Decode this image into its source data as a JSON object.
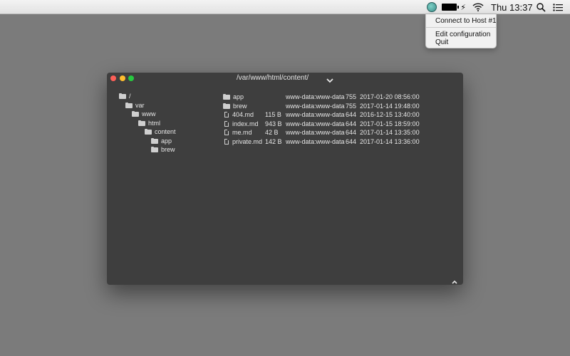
{
  "menubar": {
    "clock": "Thu 13:37",
    "icons": [
      "app-status-icon",
      "battery-icon",
      "wifi-icon",
      "search-icon",
      "list-icon"
    ]
  },
  "menu": {
    "items": [
      "Connect to Host #1",
      "Edit configuration",
      "Quit"
    ]
  },
  "window": {
    "title": "/var/www/html/content/",
    "tree": [
      {
        "label": "/",
        "depth": 0
      },
      {
        "label": "var",
        "depth": 1
      },
      {
        "label": "www",
        "depth": 2
      },
      {
        "label": "html",
        "depth": 3
      },
      {
        "label": "content",
        "depth": 4
      },
      {
        "label": "app",
        "depth": 5
      },
      {
        "label": "brew",
        "depth": 5
      }
    ],
    "files": [
      {
        "type": "folder",
        "name": "app",
        "size": "",
        "owner": "www-data:www-data",
        "perms": "755",
        "date": "2017-01-20 08:56:00"
      },
      {
        "type": "folder",
        "name": "brew",
        "size": "",
        "owner": "www-data:www-data",
        "perms": "755",
        "date": "2017-01-14 19:48:00"
      },
      {
        "type": "file",
        "name": "404.md",
        "size": "115 B",
        "owner": "www-data:www-data",
        "perms": "644",
        "date": "2016-12-15 13:40:00"
      },
      {
        "type": "file",
        "name": "index.md",
        "size": "943 B",
        "owner": "www-data:www-data",
        "perms": "644",
        "date": "2017-01-15 18:59:00"
      },
      {
        "type": "file",
        "name": "me.md",
        "size": "42 B",
        "owner": "www-data:www-data",
        "perms": "644",
        "date": "2017-01-14 13:35:00"
      },
      {
        "type": "file",
        "name": "private.md",
        "size": "142 B",
        "owner": "www-data:www-data",
        "perms": "644",
        "date": "2017-01-14 13:36:00"
      }
    ]
  }
}
